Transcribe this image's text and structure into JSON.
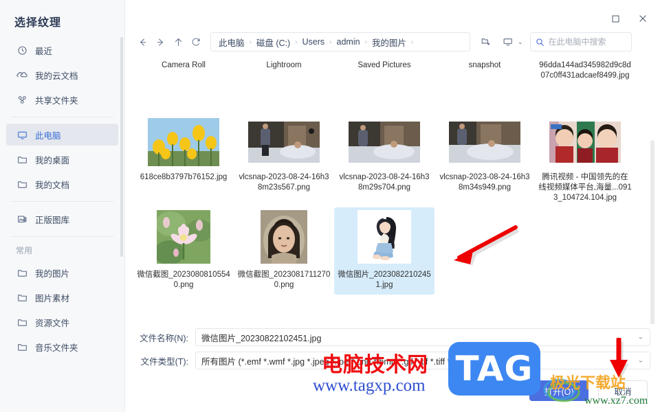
{
  "dialog": {
    "title": "选择纹理"
  },
  "sidebar": {
    "groups": [
      {
        "title": null,
        "items": [
          {
            "label": "最近",
            "icon": "clock-icon",
            "active": false
          },
          {
            "label": "我的云文档",
            "icon": "cloud-icon",
            "active": false
          },
          {
            "label": "共享文件夹",
            "icon": "share-icon",
            "active": false
          }
        ]
      },
      {
        "title": null,
        "items": [
          {
            "label": "此电脑",
            "icon": "monitor-icon",
            "active": true
          },
          {
            "label": "我的桌面",
            "icon": "folder-icon",
            "active": false
          },
          {
            "label": "我的文档",
            "icon": "folder-icon",
            "active": false
          }
        ]
      },
      {
        "title": null,
        "items": [
          {
            "label": "正版图库",
            "icon": "image-library-icon",
            "active": false
          }
        ]
      },
      {
        "title": "常用",
        "items": [
          {
            "label": "我的图片",
            "icon": "folder-icon",
            "active": false
          },
          {
            "label": "图片素材",
            "icon": "folder-icon",
            "active": false
          },
          {
            "label": "资源文件",
            "icon": "folder-icon",
            "active": false
          },
          {
            "label": "音乐文件夹",
            "icon": "folder-icon",
            "active": false
          }
        ]
      }
    ]
  },
  "window_controls": {
    "maximize_label": "□",
    "close_label": "✕"
  },
  "toolbar": {
    "back_label": "←",
    "forward_label": "→",
    "up_label": "↑",
    "refresh_label": "⟳",
    "breadcrumb": [
      "此电脑",
      "磁盘 (C:)",
      "Users",
      "admin",
      "我的图片",
      ""
    ],
    "breadcrumb_separator": "›",
    "new_folder_icon": "new-folder-icon",
    "view_icon": "view-mode-icon",
    "view_caret": "⌄"
  },
  "search": {
    "placeholder": "在此电脑中搜索",
    "value": "",
    "icon": "search-icon"
  },
  "files": {
    "folders": [
      {
        "name": "Camera Roll",
        "type": "folder"
      },
      {
        "name": "Lightroom",
        "type": "folder"
      },
      {
        "name": "Saved Pictures",
        "type": "folder"
      },
      {
        "name": "snapshot",
        "type": "folder"
      },
      {
        "name": "96dda144ad345982d9c8d07c0ff431adcaef8499.jpg",
        "type": "image"
      }
    ],
    "row2": [
      {
        "name": "618ce8b3797b76152.jpg",
        "type": "image",
        "thumb": "tulips"
      },
      {
        "name": "vlcsnap-2023-08-24-16h38m23s567.png",
        "type": "image",
        "thumb": "bedroom1"
      },
      {
        "name": "vlcsnap-2023-08-24-16h38m29s704.png",
        "type": "image",
        "thumb": "bedroom2"
      },
      {
        "name": "vlcsnap-2023-08-24-16h38m34s949.png",
        "type": "image",
        "thumb": "bedroom3"
      },
      {
        "name": "腾讯视频 - 中国领先的在线视频媒体平台,海量...0913_104724.104.jpg",
        "type": "image",
        "thumb": "tvshow"
      }
    ],
    "row3": [
      {
        "name": "微信截图_20230808105540.png",
        "type": "image",
        "thumb": "lotus",
        "selected": false
      },
      {
        "name": "微信截图_20230817112700.png",
        "type": "image",
        "thumb": "portrait",
        "selected": false
      },
      {
        "name": "微信图片_20230822102451.jpg",
        "type": "image",
        "thumb": "illustration",
        "selected": true
      }
    ]
  },
  "form": {
    "filename_label": "文件名称(N):",
    "filename_value": "微信图片_20230822102451.jpg",
    "filetype_label": "文件类型(T):",
    "filetype_value": "所有图片 (*.emf *.wmf *.jpg *.jpeg *.jpe *.png *.bmp *.gif *.tif *.tiff *.svg)",
    "dropdown_caret": "⌄"
  },
  "buttons": {
    "open_label": "打开(O)",
    "cancel_label": "取消"
  },
  "watermarks": {
    "tag_text": "电脑技术网",
    "tag_url": "www.tagxp.com",
    "tag_logo": "TAG",
    "site_name": "极光下载站",
    "site_url": "www.xz7.com"
  },
  "colors": {
    "accent": "#4b6fe0",
    "selection": "#d6ecfb",
    "sidebar_bg": "#f7f8fa",
    "arrow_red": "#ee0000",
    "watermark_red": "#ef0d10",
    "watermark_blue": "#3d87f2"
  }
}
